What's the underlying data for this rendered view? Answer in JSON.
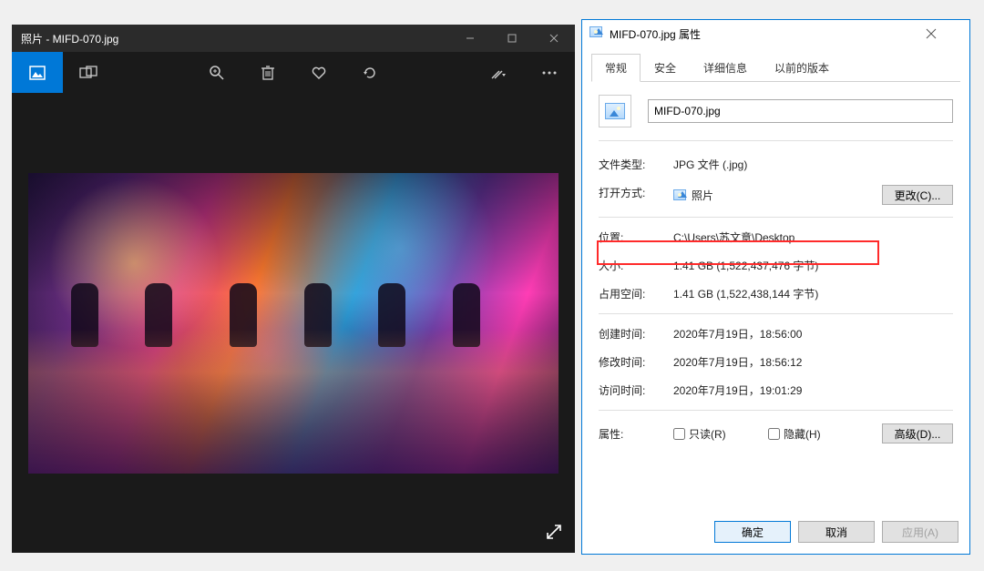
{
  "photos": {
    "title": "照片 - MIFD-070.jpg"
  },
  "props": {
    "title": "MIFD-070.jpg 属性",
    "tabs": {
      "general": "常规",
      "security": "安全",
      "details": "详细信息",
      "previous": "以前的版本"
    },
    "filename": "MIFD-070.jpg",
    "rows": {
      "filetype_k": "文件类型:",
      "filetype_v": "JPG 文件 (.jpg)",
      "openwith_k": "打开方式:",
      "openwith_v": "照片",
      "change_btn": "更改(C)...",
      "location_k": "位置:",
      "location_v": "C:\\Users\\苏文意\\Desktop",
      "size_k": "大小:",
      "size_v": "1.41 GB (1,522,437,476 字节)",
      "sizeondisk_k": "占用空间:",
      "sizeondisk_v": "1.41 GB (1,522,438,144 字节)",
      "created_k": "创建时间:",
      "created_v": "2020年7月19日，18:56:00",
      "modified_k": "修改时间:",
      "modified_v": "2020年7月19日，18:56:12",
      "accessed_k": "访问时间:",
      "accessed_v": "2020年7月19日，19:01:29",
      "attrs_k": "属性:",
      "readonly": "只读(R)",
      "hidden": "隐藏(H)",
      "advanced": "高级(D)..."
    },
    "footer": {
      "ok": "确定",
      "cancel": "取消",
      "apply": "应用(A)"
    }
  }
}
